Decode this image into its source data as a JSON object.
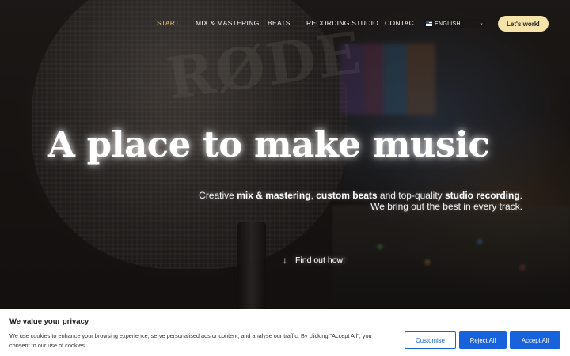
{
  "nav": {
    "items": [
      {
        "label": "START",
        "active": true
      },
      {
        "label": "MIX & MASTERING",
        "active": false
      },
      {
        "label": "BEATS",
        "active": false
      },
      {
        "label": "RECORDING STUDIO",
        "active": false
      },
      {
        "label": "CONTACT",
        "active": false
      }
    ],
    "language": {
      "label": "ENGLISH",
      "flag_icon": "us-flag-icon"
    },
    "cta_label": "Let's work!"
  },
  "hero": {
    "background_brand_text": "RØDE",
    "headline": "A place to make music",
    "subline": {
      "line1": {
        "prefix": "Creative ",
        "bold1": "mix & mastering",
        "sep1": ", ",
        "bold2": "custom beats",
        "mid": " and top-quality ",
        "bold3": "studio recording",
        "suffix": "."
      },
      "line2": "We bring out the best in every track."
    },
    "find_out": {
      "icon": "arrow-down-icon",
      "label": "Find out how!"
    }
  },
  "cookie_banner": {
    "title": "We value your privacy",
    "text": "We use cookies to enhance your browsing experience, serve personalised ads or content, and analyse our traffic. By clicking \"Accept All\", you consent to our use of cookies.",
    "buttons": {
      "customise": "Customise",
      "reject_all": "Reject All",
      "accept_all": "Accept All"
    }
  },
  "colors": {
    "nav_active": "#e8c678",
    "cta_background": "#f6e3a9",
    "cookie_button_blue": "#1863dc"
  }
}
